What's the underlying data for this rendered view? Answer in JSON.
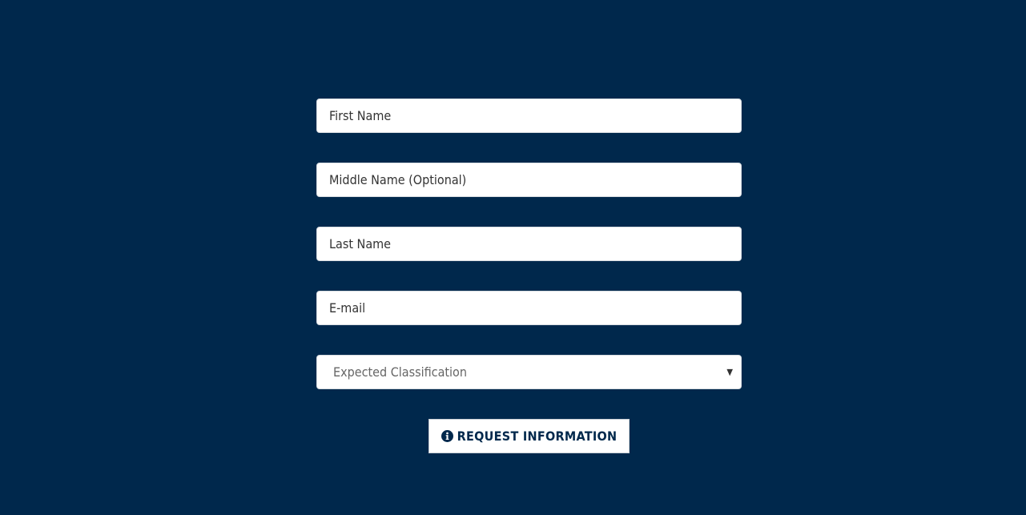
{
  "form": {
    "first_name": {
      "placeholder": "First Name",
      "value": ""
    },
    "middle_name": {
      "placeholder": "Middle Name (Optional)",
      "value": ""
    },
    "last_name": {
      "placeholder": "Last Name",
      "value": ""
    },
    "email": {
      "placeholder": "E-mail",
      "value": ""
    },
    "classification": {
      "selected": "Expected Classification"
    },
    "submit_label": "REQUEST INFORMATION",
    "submit_icon": "info-circle-icon"
  },
  "colors": {
    "background": "#00284c",
    "field_background": "#ffffff",
    "button_text": "#00284c"
  }
}
